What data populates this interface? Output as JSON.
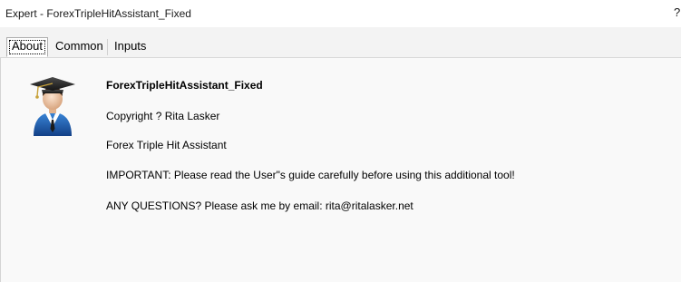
{
  "window": {
    "title": "Expert - ForexTripleHitAssistant_Fixed",
    "help_glyph": "?"
  },
  "tabs": [
    {
      "label": "About",
      "active": true
    },
    {
      "label": "Common",
      "active": false
    },
    {
      "label": "Inputs",
      "active": false
    }
  ],
  "about": {
    "icon": "graduate-avatar-icon",
    "name": "ForexTripleHitAssistant_Fixed",
    "copyright": "Copyright ? Rita Lasker",
    "description": "Forex Triple Hit Assistant",
    "important": "IMPORTANT: Please read the User\"s guide carefully before using this additional tool!",
    "questions": "ANY QUESTIONS? Please ask me by email: rita@ritalasker.net"
  },
  "colors": {
    "titlebar_bg": "#ffffff",
    "tabstrip_bg": "#f3f3f3",
    "content_bg": "#f9f9f9",
    "avatar_blue": "#1f5fb0",
    "avatar_cap": "#2b2b2b"
  }
}
